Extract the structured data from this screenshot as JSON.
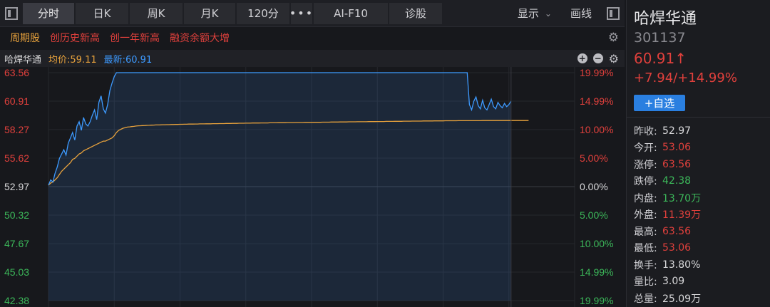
{
  "toolbar": {
    "tabs": [
      {
        "label": "分时",
        "active": true,
        "w": 72
      },
      {
        "label": "日K",
        "w": 74
      },
      {
        "label": "周K",
        "w": 74
      },
      {
        "label": "月K",
        "w": 72
      },
      {
        "label": "120分",
        "w": 74
      },
      {
        "label": "•••",
        "w": 30
      },
      {
        "label": "AI-F10",
        "w": 104
      },
      {
        "label": "诊股",
        "w": 74
      }
    ],
    "display_label": "显示",
    "draw_label": "画线"
  },
  "tags": [
    "周期股",
    "创历史新高",
    "创一年新高",
    "融资余额大增"
  ],
  "chart_header": {
    "name": "哈焊华通",
    "avg": "均价:59.11",
    "last": "最新:60.91"
  },
  "chart_data": {
    "type": "line",
    "prev_close": 52.97,
    "y_left_ticks": [
      "63.56",
      "60.91",
      "58.27",
      "55.62",
      "52.97",
      "50.32",
      "47.67",
      "45.03",
      "42.38"
    ],
    "y_right_ticks": [
      "19.99%",
      "14.99%",
      "10.00%",
      "5.00%",
      "0.00%",
      "5.00%",
      "10.00%",
      "14.99%",
      "19.99%"
    ],
    "ylim": [
      42.38,
      63.56
    ],
    "total_minutes": 240,
    "series": [
      {
        "name": "最新",
        "color": "#3d9aff",
        "values": [
          53.1,
          53.6,
          53.4,
          54.2,
          54.8,
          55.6,
          56.0,
          56.4,
          55.9,
          57.0,
          57.5,
          58.0,
          57.3,
          58.6,
          59.0,
          58.2,
          59.4,
          58.8,
          58.6,
          59.0,
          59.6,
          60.1,
          59.2,
          60.8,
          61.4,
          60.2,
          59.8,
          60.6,
          61.9,
          62.6,
          63.2,
          63.56,
          63.56,
          63.56,
          63.56,
          63.56,
          63.56,
          63.56,
          63.56,
          63.56,
          63.56,
          63.56,
          63.56,
          63.56,
          63.56,
          63.56,
          63.56,
          63.56,
          63.56,
          63.56,
          63.56,
          63.56,
          63.56,
          63.56,
          63.56,
          63.56,
          63.56,
          63.56,
          63.56,
          63.56,
          63.56,
          63.56,
          63.56,
          63.56,
          63.56,
          63.56,
          63.56,
          63.56,
          63.56,
          63.56,
          63.56,
          63.56,
          63.56,
          63.56,
          63.56,
          63.56,
          63.56,
          63.56,
          63.56,
          63.56,
          63.56,
          63.56,
          63.56,
          63.56,
          63.56,
          63.56,
          63.56,
          63.56,
          63.56,
          63.56,
          63.56,
          63.56,
          63.56,
          63.56,
          63.56,
          63.56,
          63.56,
          63.56,
          63.56,
          63.56,
          63.56,
          63.56,
          63.56,
          63.56,
          63.56,
          63.56,
          63.56,
          63.56,
          63.56,
          63.56,
          63.56,
          63.56,
          63.56,
          63.56,
          63.56,
          63.56,
          63.56,
          63.56,
          63.56,
          63.56,
          63.56,
          63.56,
          63.56,
          63.56,
          63.56,
          63.56,
          63.56,
          63.56,
          63.56,
          63.56,
          63.56,
          63.56,
          63.56,
          63.56,
          63.56,
          63.56,
          63.56,
          63.56,
          63.56,
          63.56,
          63.56,
          63.56,
          63.56,
          63.56,
          63.56,
          63.56,
          63.56,
          63.56,
          63.56,
          63.56,
          63.56,
          63.56,
          63.56,
          63.56,
          63.56,
          63.56,
          63.56,
          63.56,
          63.56,
          63.56,
          63.56,
          63.56,
          63.56,
          63.56,
          63.56,
          63.56,
          63.56,
          63.56,
          63.56,
          63.56,
          63.56,
          63.56,
          63.56,
          63.56,
          63.56,
          63.56,
          63.56,
          63.56,
          63.56,
          63.56,
          63.56,
          63.56,
          63.56,
          63.56,
          63.56,
          63.56,
          63.56,
          63.56,
          63.56,
          63.56,
          63.56,
          63.56,
          60.6,
          60.1,
          60.9,
          61.3,
          60.5,
          60.2,
          61.0,
          60.3,
          60.1,
          60.6,
          61.1,
          60.4,
          60.2,
          60.8,
          60.5,
          60.3,
          60.7,
          60.4,
          60.6,
          60.91
        ]
      },
      {
        "name": "均价",
        "color": "#e8a23c",
        "values": [
          53.1,
          53.3,
          53.4,
          53.6,
          53.8,
          54.1,
          54.4,
          54.6,
          54.8,
          55.0,
          55.2,
          55.5,
          55.6,
          55.8,
          56.0,
          56.1,
          56.3,
          56.4,
          56.5,
          56.6,
          56.7,
          56.8,
          56.9,
          57.0,
          57.1,
          57.2,
          57.2,
          57.3,
          57.4,
          57.5,
          57.7,
          58.0,
          58.2,
          58.3,
          58.4,
          58.45,
          58.5,
          58.52,
          58.55,
          58.57,
          58.6,
          58.62,
          58.63,
          58.64,
          58.65,
          58.66,
          58.67,
          58.68,
          58.69,
          58.7,
          58.7,
          58.71,
          58.72,
          58.72,
          58.73,
          58.73,
          58.74,
          58.74,
          58.75,
          58.75,
          58.76,
          58.76,
          58.77,
          58.77,
          58.78,
          58.78,
          58.78,
          58.79,
          58.79,
          58.8,
          58.8,
          58.8,
          58.81,
          58.81,
          58.81,
          58.82,
          58.82,
          58.82,
          58.83,
          58.83,
          58.83,
          58.84,
          58.84,
          58.84,
          58.85,
          58.85,
          58.85,
          58.86,
          58.86,
          58.86,
          58.87,
          58.87,
          58.87,
          58.88,
          58.88,
          58.88,
          58.88,
          58.89,
          58.89,
          58.89,
          58.89,
          58.9,
          58.9,
          58.9,
          58.9,
          58.91,
          58.91,
          58.91,
          58.91,
          58.92,
          58.92,
          58.92,
          58.92,
          58.93,
          58.93,
          58.93,
          58.93,
          58.94,
          58.94,
          58.94,
          58.94,
          58.95,
          58.95,
          58.95,
          58.95,
          58.96,
          58.96,
          58.96,
          58.96,
          58.97,
          58.97,
          58.97,
          58.97,
          58.98,
          58.98,
          58.98,
          58.98,
          58.99,
          58.99,
          58.99,
          58.99,
          59.0,
          59.0,
          59.0,
          59.0,
          59.0,
          59.01,
          59.01,
          59.01,
          59.01,
          59.02,
          59.02,
          59.02,
          59.02,
          59.03,
          59.03,
          59.03,
          59.03,
          59.04,
          59.04,
          59.04,
          59.04,
          59.05,
          59.05,
          59.05,
          59.05,
          59.06,
          59.06,
          59.06,
          59.06,
          59.06,
          59.07,
          59.07,
          59.07,
          59.07,
          59.07,
          59.08,
          59.08,
          59.08,
          59.08,
          59.08,
          59.09,
          59.09,
          59.09,
          59.09,
          59.09,
          59.09,
          59.1,
          59.1,
          59.1,
          59.1,
          59.1,
          59.1,
          59.1,
          59.1,
          59.1,
          59.1,
          59.1,
          59.11,
          59.11,
          59.11,
          59.11,
          59.11,
          59.11,
          59.11,
          59.11,
          59.11,
          59.11,
          59.11,
          59.11,
          59.11,
          59.11,
          59.11,
          59.11,
          59.11,
          59.11,
          59.11,
          59.11,
          59.11,
          59.11
        ]
      }
    ]
  },
  "stock": {
    "name": "哈焊华通",
    "code": "301137",
    "price": "60.91↑",
    "change": "+7.94/+14.99%",
    "add_label": "+自选"
  },
  "stats": [
    {
      "k": "昨收:",
      "v": "52.97",
      "c": "white"
    },
    {
      "k": "今开:",
      "v": "53.06",
      "c": "red"
    },
    {
      "k": "涨停:",
      "v": "63.56",
      "c": "red"
    },
    {
      "k": "跌停:",
      "v": "42.38",
      "c": "green"
    },
    {
      "k": "内盘:",
      "v": "13.70万",
      "c": "green"
    },
    {
      "k": "外盘:",
      "v": "11.39万",
      "c": "red"
    },
    {
      "k": "最高:",
      "v": "63.56",
      "c": "red"
    },
    {
      "k": "最低:",
      "v": "53.06",
      "c": "red"
    },
    {
      "k": "换手:",
      "v": "13.80%",
      "c": "white"
    },
    {
      "k": "量比:",
      "v": "3.09",
      "c": "white"
    },
    {
      "k": "总量:",
      "v": "25.09万",
      "c": "white"
    }
  ]
}
